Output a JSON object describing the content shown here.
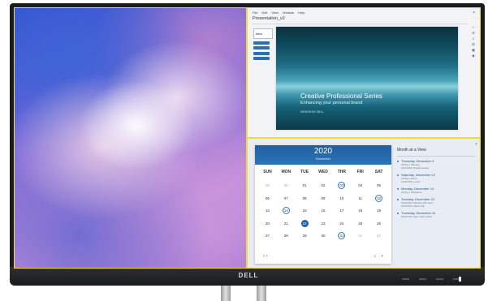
{
  "brand": "DELL",
  "presentation": {
    "menu": [
      "File",
      "Edit",
      "View",
      "Window",
      "Help"
    ],
    "close_glyph": "×",
    "title": "Presentation_v2",
    "thumb_label": "Intro",
    "slide": {
      "title": "Creative Professional Series",
      "subtitle": "Enhancing your personal brand",
      "small": "DESIGN BY DELL"
    },
    "tools": [
      "+",
      "⊕",
      "≡",
      "⊞",
      "▣",
      "◆"
    ]
  },
  "calendar": {
    "year": "2020",
    "month": "December",
    "weekdays": [
      "SUN",
      "MON",
      "TUE",
      "WED",
      "THR",
      "FRI",
      "SAT"
    ],
    "days": [
      {
        "d": "29",
        "m": true
      },
      {
        "d": "30",
        "m": true
      },
      {
        "d": "01"
      },
      {
        "d": "02"
      },
      {
        "d": "03",
        "r": true
      },
      {
        "d": "04"
      },
      {
        "d": "05"
      },
      {
        "d": "06"
      },
      {
        "d": "07"
      },
      {
        "d": "08"
      },
      {
        "d": "09"
      },
      {
        "d": "10"
      },
      {
        "d": "11"
      },
      {
        "d": "12",
        "r": true
      },
      {
        "d": "13"
      },
      {
        "d": "14",
        "r": true
      },
      {
        "d": "15"
      },
      {
        "d": "16"
      },
      {
        "d": "17"
      },
      {
        "d": "18"
      },
      {
        "d": "19"
      },
      {
        "d": "20"
      },
      {
        "d": "21"
      },
      {
        "d": "22",
        "t": true
      },
      {
        "d": "23"
      },
      {
        "d": "24"
      },
      {
        "d": "25"
      },
      {
        "d": "26"
      },
      {
        "d": "27"
      },
      {
        "d": "28"
      },
      {
        "d": "29"
      },
      {
        "d": "30"
      },
      {
        "d": "31",
        "r": true
      },
      {
        "d": "01",
        "m": true
      },
      {
        "d": "02",
        "m": true
      }
    ],
    "nav": "‹  ›",
    "search_glyph": "⌕",
    "add_glyph": "+"
  },
  "month_at_a_view": {
    "title": "Month at a View",
    "close_glyph": "×",
    "events": [
      {
        "date": "Thursday, December 3",
        "lines": [
          "All Day | Meeting",
          "10:00 AM | Project review"
        ]
      },
      {
        "date": "Saturday, December 12",
        "lines": [
          "All Day | Event",
          "12:00 PM | Lunch"
        ]
      },
      {
        "date": "Monday, December 14",
        "lines": [
          "All Day | Workshop"
        ]
      },
      {
        "date": "Tuesday, December 22",
        "lines": [
          "10:00 AM | Meeting with team",
          "02:00 PM | Client call"
        ]
      },
      {
        "date": "Thursday, December 31",
        "lines": [
          "09:00 PM | New Year's Party"
        ]
      }
    ]
  }
}
